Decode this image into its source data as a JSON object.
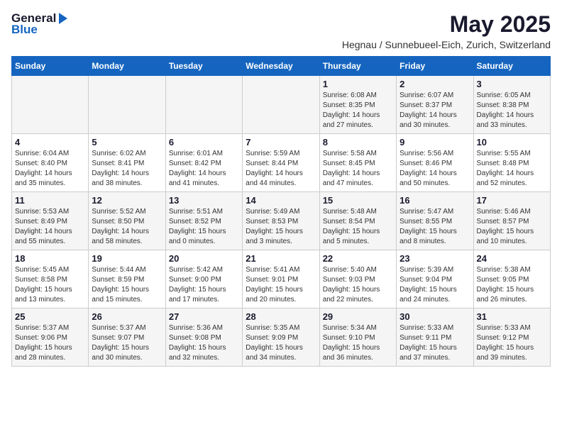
{
  "header": {
    "logo_general": "General",
    "logo_blue": "Blue",
    "title": "May 2025",
    "subtitle": "Hegnau / Sunnebueel-Eich, Zurich, Switzerland"
  },
  "calendar": {
    "days_of_week": [
      "Sunday",
      "Monday",
      "Tuesday",
      "Wednesday",
      "Thursday",
      "Friday",
      "Saturday"
    ],
    "weeks": [
      {
        "bg": "odd",
        "days": [
          {
            "date": "",
            "info": ""
          },
          {
            "date": "",
            "info": ""
          },
          {
            "date": "",
            "info": ""
          },
          {
            "date": "",
            "info": ""
          },
          {
            "date": "1",
            "info": "Sunrise: 6:08 AM\nSunset: 8:35 PM\nDaylight: 14 hours\nand 27 minutes."
          },
          {
            "date": "2",
            "info": "Sunrise: 6:07 AM\nSunset: 8:37 PM\nDaylight: 14 hours\nand 30 minutes."
          },
          {
            "date": "3",
            "info": "Sunrise: 6:05 AM\nSunset: 8:38 PM\nDaylight: 14 hours\nand 33 minutes."
          }
        ]
      },
      {
        "bg": "even",
        "days": [
          {
            "date": "4",
            "info": "Sunrise: 6:04 AM\nSunset: 8:40 PM\nDaylight: 14 hours\nand 35 minutes."
          },
          {
            "date": "5",
            "info": "Sunrise: 6:02 AM\nSunset: 8:41 PM\nDaylight: 14 hours\nand 38 minutes."
          },
          {
            "date": "6",
            "info": "Sunrise: 6:01 AM\nSunset: 8:42 PM\nDaylight: 14 hours\nand 41 minutes."
          },
          {
            "date": "7",
            "info": "Sunrise: 5:59 AM\nSunset: 8:44 PM\nDaylight: 14 hours\nand 44 minutes."
          },
          {
            "date": "8",
            "info": "Sunrise: 5:58 AM\nSunset: 8:45 PM\nDaylight: 14 hours\nand 47 minutes."
          },
          {
            "date": "9",
            "info": "Sunrise: 5:56 AM\nSunset: 8:46 PM\nDaylight: 14 hours\nand 50 minutes."
          },
          {
            "date": "10",
            "info": "Sunrise: 5:55 AM\nSunset: 8:48 PM\nDaylight: 14 hours\nand 52 minutes."
          }
        ]
      },
      {
        "bg": "odd",
        "days": [
          {
            "date": "11",
            "info": "Sunrise: 5:53 AM\nSunset: 8:49 PM\nDaylight: 14 hours\nand 55 minutes."
          },
          {
            "date": "12",
            "info": "Sunrise: 5:52 AM\nSunset: 8:50 PM\nDaylight: 14 hours\nand 58 minutes."
          },
          {
            "date": "13",
            "info": "Sunrise: 5:51 AM\nSunset: 8:52 PM\nDaylight: 15 hours\nand 0 minutes."
          },
          {
            "date": "14",
            "info": "Sunrise: 5:49 AM\nSunset: 8:53 PM\nDaylight: 15 hours\nand 3 minutes."
          },
          {
            "date": "15",
            "info": "Sunrise: 5:48 AM\nSunset: 8:54 PM\nDaylight: 15 hours\nand 5 minutes."
          },
          {
            "date": "16",
            "info": "Sunrise: 5:47 AM\nSunset: 8:55 PM\nDaylight: 15 hours\nand 8 minutes."
          },
          {
            "date": "17",
            "info": "Sunrise: 5:46 AM\nSunset: 8:57 PM\nDaylight: 15 hours\nand 10 minutes."
          }
        ]
      },
      {
        "bg": "even",
        "days": [
          {
            "date": "18",
            "info": "Sunrise: 5:45 AM\nSunset: 8:58 PM\nDaylight: 15 hours\nand 13 minutes."
          },
          {
            "date": "19",
            "info": "Sunrise: 5:44 AM\nSunset: 8:59 PM\nDaylight: 15 hours\nand 15 minutes."
          },
          {
            "date": "20",
            "info": "Sunrise: 5:42 AM\nSunset: 9:00 PM\nDaylight: 15 hours\nand 17 minutes."
          },
          {
            "date": "21",
            "info": "Sunrise: 5:41 AM\nSunset: 9:01 PM\nDaylight: 15 hours\nand 20 minutes."
          },
          {
            "date": "22",
            "info": "Sunrise: 5:40 AM\nSunset: 9:03 PM\nDaylight: 15 hours\nand 22 minutes."
          },
          {
            "date": "23",
            "info": "Sunrise: 5:39 AM\nSunset: 9:04 PM\nDaylight: 15 hours\nand 24 minutes."
          },
          {
            "date": "24",
            "info": "Sunrise: 5:38 AM\nSunset: 9:05 PM\nDaylight: 15 hours\nand 26 minutes."
          }
        ]
      },
      {
        "bg": "odd",
        "days": [
          {
            "date": "25",
            "info": "Sunrise: 5:37 AM\nSunset: 9:06 PM\nDaylight: 15 hours\nand 28 minutes."
          },
          {
            "date": "26",
            "info": "Sunrise: 5:37 AM\nSunset: 9:07 PM\nDaylight: 15 hours\nand 30 minutes."
          },
          {
            "date": "27",
            "info": "Sunrise: 5:36 AM\nSunset: 9:08 PM\nDaylight: 15 hours\nand 32 minutes."
          },
          {
            "date": "28",
            "info": "Sunrise: 5:35 AM\nSunset: 9:09 PM\nDaylight: 15 hours\nand 34 minutes."
          },
          {
            "date": "29",
            "info": "Sunrise: 5:34 AM\nSunset: 9:10 PM\nDaylight: 15 hours\nand 36 minutes."
          },
          {
            "date": "30",
            "info": "Sunrise: 5:33 AM\nSunset: 9:11 PM\nDaylight: 15 hours\nand 37 minutes."
          },
          {
            "date": "31",
            "info": "Sunrise: 5:33 AM\nSunset: 9:12 PM\nDaylight: 15 hours\nand 39 minutes."
          }
        ]
      }
    ]
  }
}
